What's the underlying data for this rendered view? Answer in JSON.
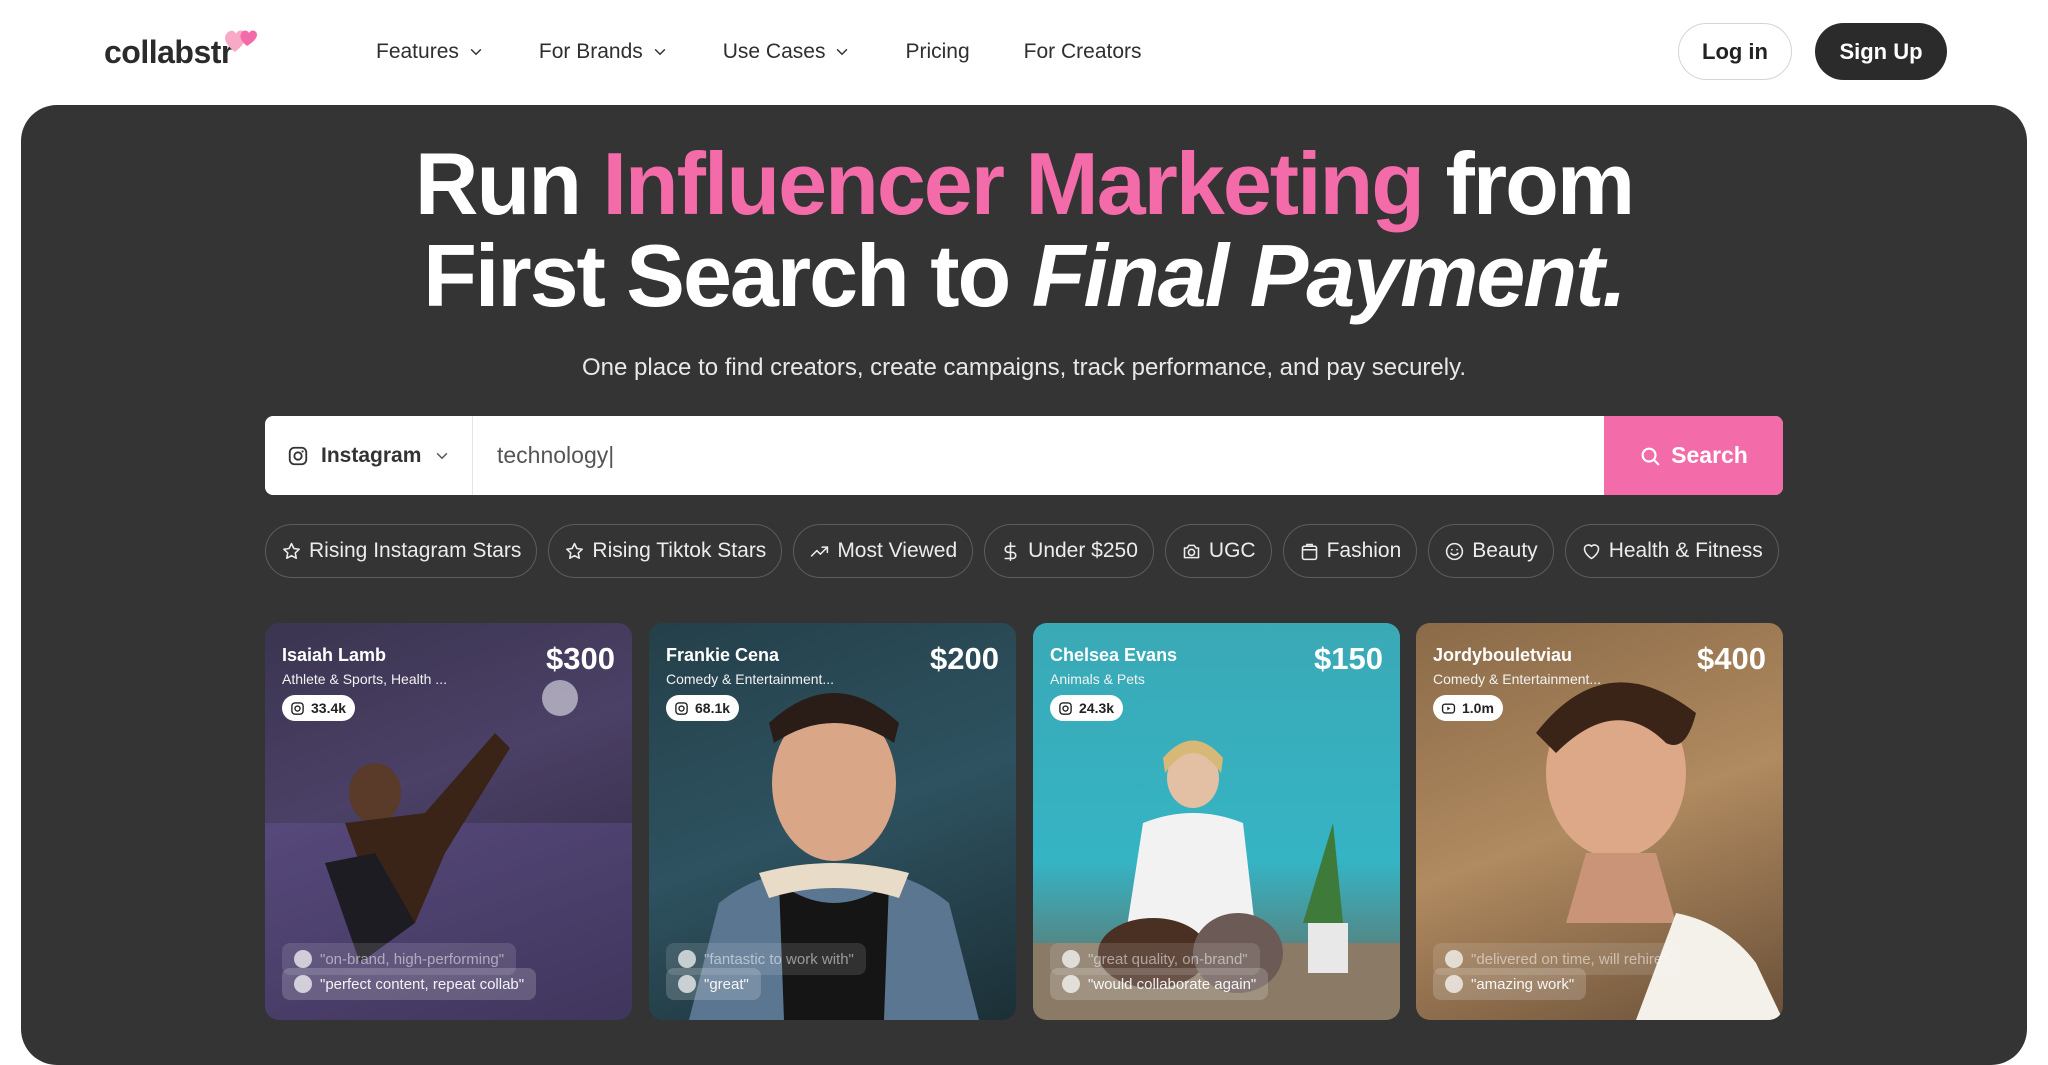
{
  "brand": {
    "name": "collabstr",
    "accent": "#f36ba8",
    "dark": "#343434"
  },
  "nav": {
    "links": [
      {
        "label": "Features",
        "dropdown": true
      },
      {
        "label": "For Brands",
        "dropdown": true
      },
      {
        "label": "Use Cases",
        "dropdown": true
      },
      {
        "label": "Pricing",
        "dropdown": false
      },
      {
        "label": "For Creators",
        "dropdown": false
      }
    ],
    "login_label": "Log in",
    "signup_label": "Sign Up"
  },
  "hero": {
    "line1_a": "Run ",
    "line1_pink": "Influencer Marketing",
    "line1_b": " from",
    "line2_a": "First Search to ",
    "line2_italic": "Final Payment.",
    "subtitle": "One place to find creators, create campaigns, track performance, and pay securely."
  },
  "search": {
    "platform": "Instagram",
    "platform_icon": "instagram-icon",
    "value": "technology|",
    "button_label": "Search"
  },
  "chips": [
    {
      "label": "Rising Instagram Stars",
      "icon": "star-icon"
    },
    {
      "label": "Rising Tiktok Stars",
      "icon": "star-icon"
    },
    {
      "label": "Most Viewed",
      "icon": "trending-icon"
    },
    {
      "label": "Under $250",
      "icon": "dollar-icon"
    },
    {
      "label": "UGC",
      "icon": "camera-icon"
    },
    {
      "label": "Fashion",
      "icon": "bag-icon"
    },
    {
      "label": "Beauty",
      "icon": "smile-icon"
    },
    {
      "label": "Health & Fitness",
      "icon": "heart-icon"
    }
  ],
  "cards": [
    {
      "name": "Isaiah Lamb",
      "category": "Athlete & Sports, Health ...",
      "price": "$300",
      "platform": "instagram-icon",
      "followers": "33.4k",
      "reviews": [
        "\"on-brand, high-performing\"",
        "\"perfect content, repeat collab\""
      ]
    },
    {
      "name": "Frankie Cena",
      "category": "Comedy & Entertainment...",
      "price": "$200",
      "platform": "instagram-icon",
      "followers": "68.1k",
      "reviews": [
        "\"fantastic to work with\"",
        "\"great\""
      ]
    },
    {
      "name": "Chelsea Evans",
      "category": "Animals & Pets",
      "price": "$150",
      "platform": "instagram-icon",
      "followers": "24.3k",
      "reviews": [
        "\"great quality, on-brand\"",
        "\"would collaborate again\""
      ]
    },
    {
      "name": "Jordybouletviau",
      "category": "Comedy & Entertainment...",
      "price": "$400",
      "platform": "youtube-icon",
      "followers": "1.0m",
      "reviews": [
        "\"delivered on time, will rehire\"",
        "\"amazing work\""
      ]
    }
  ]
}
